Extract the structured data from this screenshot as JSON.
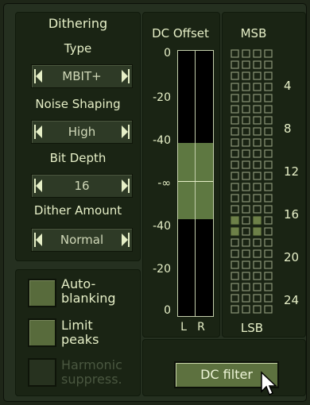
{
  "dithering": {
    "title": "Dithering",
    "type": {
      "label": "Type",
      "value": "MBIT+"
    },
    "noise_shaping": {
      "label": "Noise Shaping",
      "value": "High"
    },
    "bit_depth": {
      "label": "Bit Depth",
      "value": "16"
    },
    "dither_amount": {
      "label": "Dither Amount",
      "value": "Normal"
    }
  },
  "checkboxes": {
    "auto_blanking": {
      "line1": "Auto-",
      "line2": "blanking",
      "checked": false
    },
    "limit_peaks": {
      "line1": "Limit",
      "line2": "peaks",
      "checked": false
    },
    "harmonic_suppress": {
      "line1": "Harmonic",
      "line2": "suppress.",
      "enabled": false
    }
  },
  "dc_offset": {
    "title": "DC Offset",
    "ticks": [
      "0",
      "-20",
      "-40",
      "-∞",
      "-40",
      "-20",
      "0"
    ],
    "channel_left": "L",
    "channel_right": "R"
  },
  "msb": {
    "title": "MSB",
    "bottom_label": "LSB",
    "bit_labels": [
      "4",
      "8",
      "12",
      "16",
      "20",
      "24"
    ],
    "active_bits": [
      16,
      17
    ]
  },
  "dc_filter_button": "DC filter",
  "colors": {
    "panel": "#1a2414",
    "text": "#e6efc7",
    "led_on": "#6d8048",
    "meter_fill": "#5e7841"
  }
}
